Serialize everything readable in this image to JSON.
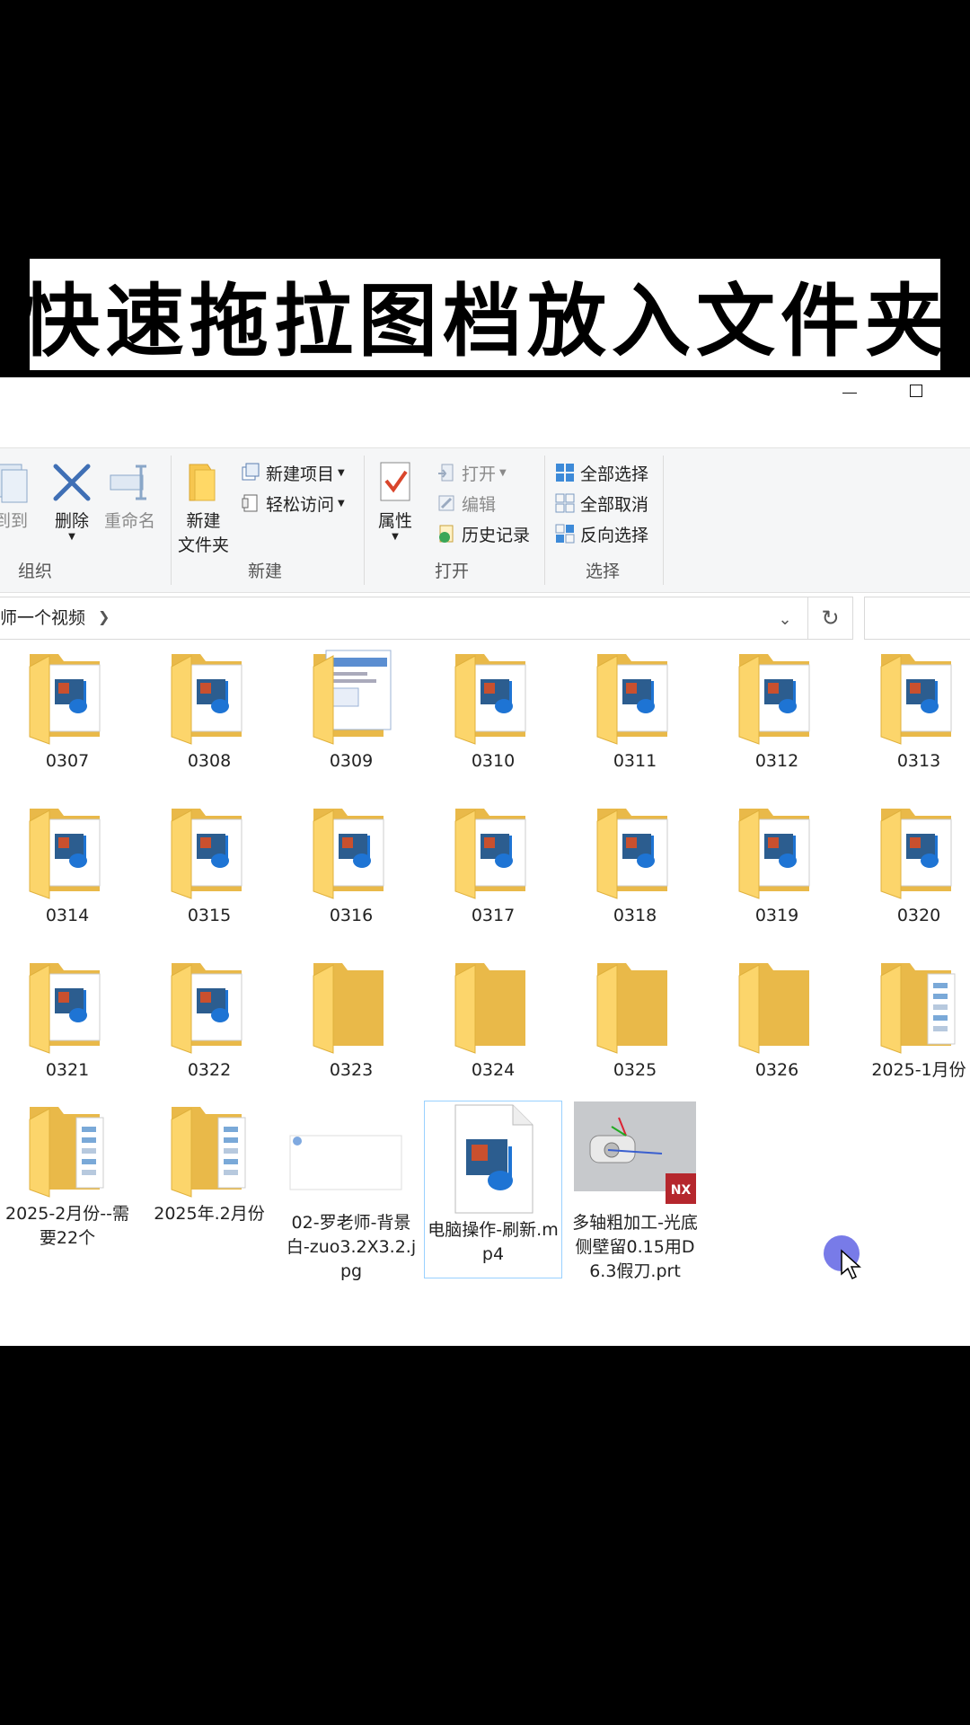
{
  "banner": {
    "text": "快速拖拉图档放入文件夹"
  },
  "ribbon": {
    "organize": {
      "copy_to_label": "到到",
      "group_label": "组织",
      "delete_label": "删除",
      "rename_label": "重命名"
    },
    "new": {
      "new_folder_label_1": "新建",
      "new_folder_label_2": "文件夹",
      "new_item_label": "新建项目",
      "easy_access_label": "轻松访问",
      "group_label": "新建"
    },
    "open": {
      "properties_label": "属性",
      "open_label": "打开",
      "edit_label": "编辑",
      "history_label": "历史记录",
      "group_label": "打开"
    },
    "select": {
      "select_all_label": "全部选择",
      "select_none_label": "全部取消",
      "invert_label": "反向选择",
      "group_label": "选择"
    }
  },
  "address": {
    "path_text": "师一个视频"
  },
  "files": [
    {
      "name": "0307",
      "icon": "folder-video-icon"
    },
    {
      "name": "0308",
      "icon": "folder-video-icon"
    },
    {
      "name": "0309",
      "icon": "folder-doc-icon"
    },
    {
      "name": "0310",
      "icon": "folder-video-icon"
    },
    {
      "name": "0311",
      "icon": "folder-video-icon"
    },
    {
      "name": "0312",
      "icon": "folder-video-icon"
    },
    {
      "name": "0313",
      "icon": "folder-video-icon"
    },
    {
      "name": "0314",
      "icon": "folder-video-icon"
    },
    {
      "name": "0315",
      "icon": "folder-video-icon"
    },
    {
      "name": "0316",
      "icon": "folder-video-icon"
    },
    {
      "name": "0317",
      "icon": "folder-video-icon"
    },
    {
      "name": "0318",
      "icon": "folder-video-icon"
    },
    {
      "name": "0319",
      "icon": "folder-video-icon"
    },
    {
      "name": "0320",
      "icon": "folder-video-icon"
    },
    {
      "name": "0321",
      "icon": "folder-video-icon"
    },
    {
      "name": "0322",
      "icon": "folder-video-icon"
    },
    {
      "name": "0323",
      "icon": "folder-empty-icon"
    },
    {
      "name": "0324",
      "icon": "folder-empty-icon"
    },
    {
      "name": "0325",
      "icon": "folder-empty-icon"
    },
    {
      "name": "0326",
      "icon": "folder-empty-icon"
    },
    {
      "name": "2025-1月份",
      "icon": "folder-docs-icon"
    },
    {
      "name": "2025-2月份--需要22个",
      "icon": "folder-docs-icon"
    },
    {
      "name": "2025年.2月份",
      "icon": "folder-docs-icon"
    },
    {
      "name": "02-罗老师-背景白-zuo3.2X3.2.jpg",
      "icon": "image-file-icon"
    },
    {
      "name": "电脑操作-刷新.mp4",
      "icon": "video-file-icon",
      "selected": true
    },
    {
      "name": "多轴粗加工-光底侧壁留0.15用D6.3假刀.prt",
      "icon": "nx-part-icon"
    }
  ]
}
